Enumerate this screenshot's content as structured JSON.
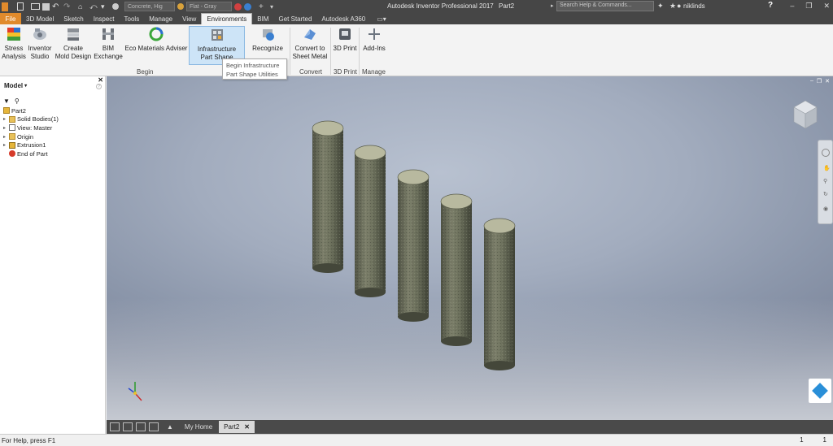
{
  "window": {
    "title": "Autodesk Inventor Professional 2017",
    "file": "Part2",
    "search_placeholder": "Search Help & Commands...",
    "user": "niklinds",
    "material": "Concrete, Hig",
    "appearance": "Flat - Gray"
  },
  "tabs": [
    {
      "label": "File"
    },
    {
      "label": "3D Model"
    },
    {
      "label": "Sketch"
    },
    {
      "label": "Inspect"
    },
    {
      "label": "Tools"
    },
    {
      "label": "Manage"
    },
    {
      "label": "View"
    },
    {
      "label": "Environments"
    },
    {
      "label": "BIM"
    },
    {
      "label": "Get Started"
    },
    {
      "label": "Autodesk A360"
    }
  ],
  "ribbon": {
    "stress": "Stress\nAnalysis",
    "studio": "Inventor\nStudio",
    "mold": "Create\nMold Design",
    "bim": "BIM\nExchange",
    "eco": "Eco Materials Adviser",
    "infra": "Infrastructure\nPart Shape",
    "recognize": "Recognize",
    "sheet": "Convert to\nSheet Metal",
    "print3d": "3D Print",
    "addins": "Add-Ins",
    "panels": {
      "begin": "Begin",
      "convert": "Convert",
      "print": "3D Print",
      "manage": "Manage"
    },
    "tooltip": "Begin Infrastructure\nPart Shape Utilities"
  },
  "browser": {
    "title": "Model",
    "root": "Part2",
    "items": [
      {
        "label": "Solid Bodies(1)"
      },
      {
        "label": "View: Master"
      },
      {
        "label": "Origin"
      },
      {
        "label": "Extrusion1"
      },
      {
        "label": "End of Part"
      }
    ]
  },
  "doc_tabs": {
    "home": "My Home",
    "part": "Part2"
  },
  "status": {
    "help": "For Help, press F1",
    "count1": "1",
    "count2": "1"
  },
  "colors": {
    "file_tab": "#e08a2c",
    "viewport": "#a2acbe",
    "cylinder": "#6f7260"
  }
}
